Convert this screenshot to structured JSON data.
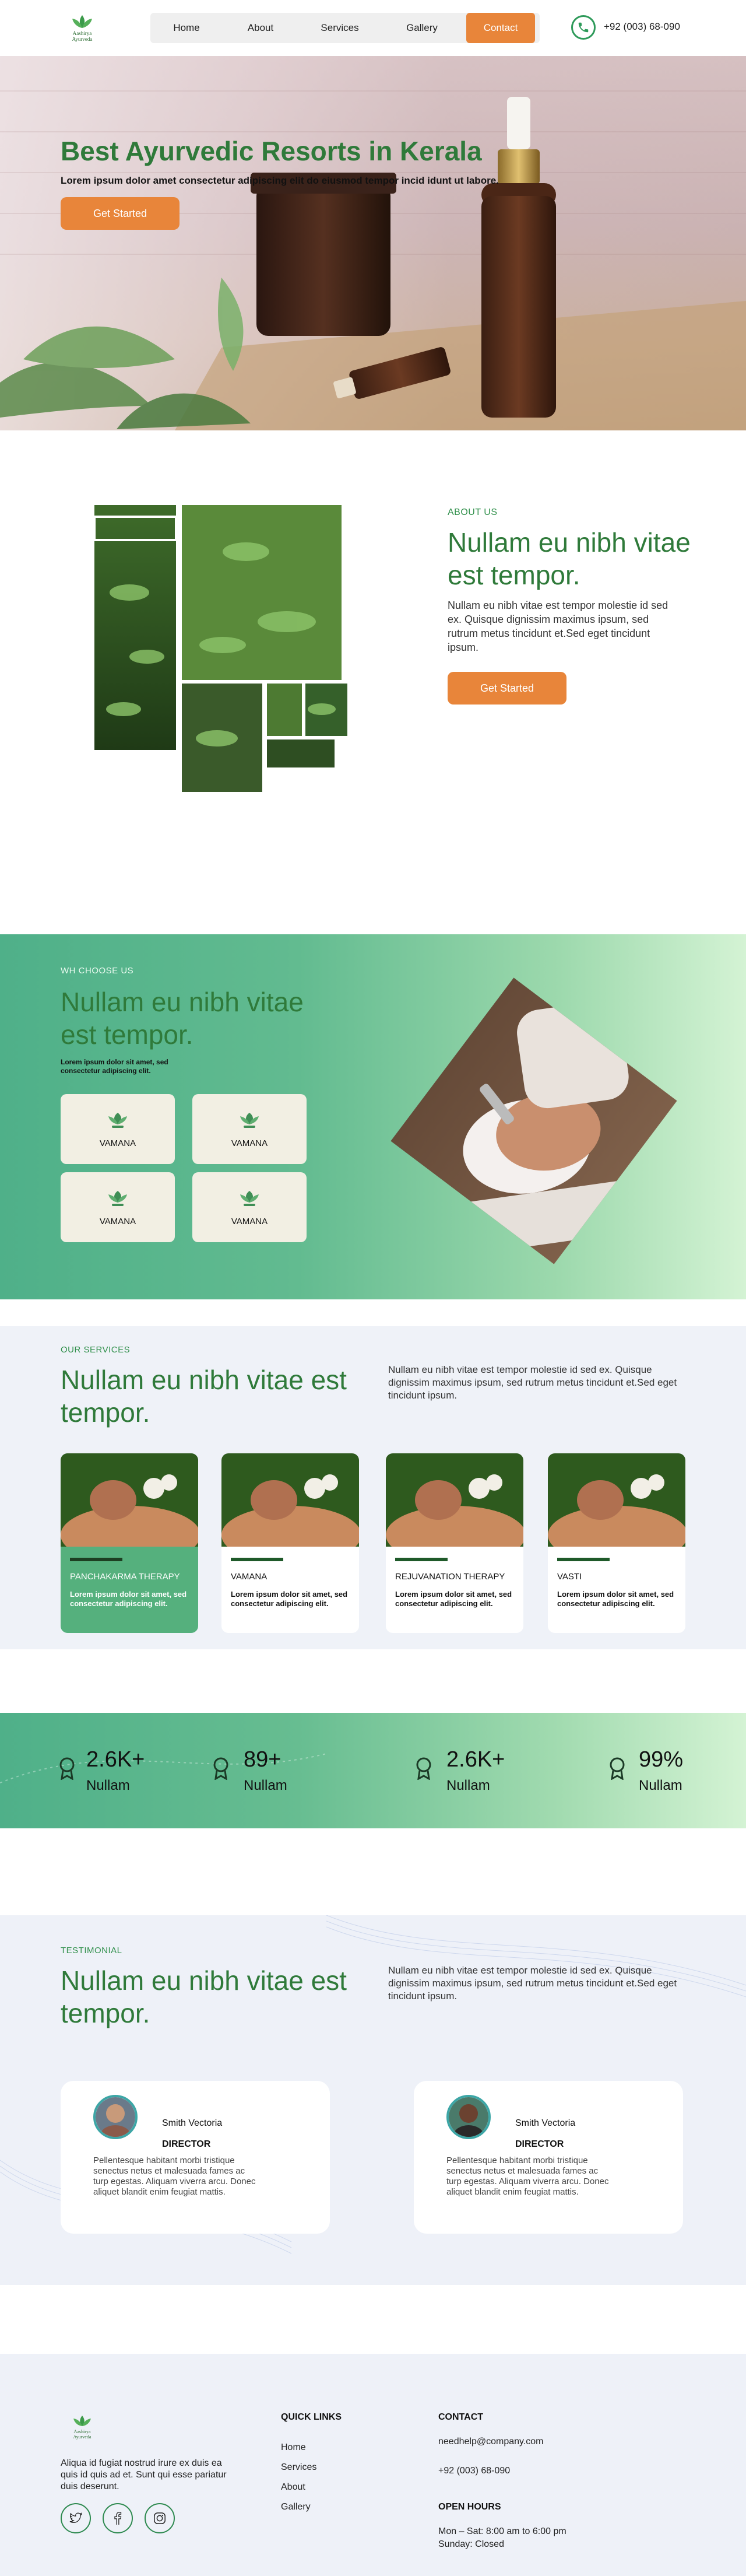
{
  "brand": {
    "logo_text_1": "Aashirya",
    "logo_text_2": "Ayurveda",
    "accent": "#e8853a",
    "green_primary": "#2f7a3a",
    "green_gradient_start": "#4fb089",
    "green_gradient_end": "#d4f3d4"
  },
  "nav": {
    "items": [
      "Home",
      "About",
      "Services",
      "Gallery",
      "Contact"
    ],
    "active": "Contact",
    "phone": "+92 (003) 68-090"
  },
  "hero": {
    "title": "Best Ayurvedic Resorts in Kerala",
    "subtitle": "Lorem ipsum dolor amet consectetur adipiscing elit do eiusmod tempor incid idunt ut labore.",
    "button": "Get Started"
  },
  "about": {
    "label": "ABOUT US",
    "title": "Nullam eu nibh vitae est tempor.",
    "text": "Nullam eu nibh vitae est tempor molestie id sed ex. Quisque dignissim maximus ipsum, sed rutrum metus tincidunt et.Sed eget tincidunt ipsum.",
    "button": "Get Started"
  },
  "why": {
    "label": "WH CHOOSE US",
    "title": "Nullam eu nibh vitae est tempor.",
    "text": "Lorem ipsum dolor sit amet, sed consectetur adipiscing elit.",
    "cards": [
      "VAMANA",
      "VAMANA",
      "VAMANA",
      "VAMANA"
    ]
  },
  "services": {
    "label": "OUR SERVICES",
    "title": "Nullam eu nibh vitae est tempor.",
    "text": "Nullam eu nibh vitae est tempor molestie id sed ex. Quisque dignissim maximus ipsum, sed rutrum metus tincidunt et.Sed eget tincidunt ipsum.",
    "cards": [
      {
        "name": "PANCHAKARMA THERAPY",
        "desc": "Lorem ipsum dolor sit amet, sed consectetur adipiscing elit."
      },
      {
        "name": "VAMANA",
        "desc": "Lorem ipsum dolor sit amet, sed consectetur adipiscing elit."
      },
      {
        "name": "REJUVANATION THERAPY",
        "desc": "Lorem ipsum dolor sit amet, sed consectetur adipiscing elit."
      },
      {
        "name": "VASTI",
        "desc": "Lorem ipsum dolor sit amet, sed consectetur adipiscing elit."
      }
    ]
  },
  "stats": [
    {
      "value": "2.6K+",
      "label": "Nullam"
    },
    {
      "value": "89+",
      "label": "Nullam"
    },
    {
      "value": "2.6K+",
      "label": "Nullam"
    },
    {
      "value": "99%",
      "label": "Nullam"
    }
  ],
  "testimonial": {
    "label": "TESTIMONIAL",
    "title": "Nullam eu nibh vitae est tempor.",
    "text": "Nullam eu nibh vitae est tempor molestie id sed ex. Quisque dignissim maximus ipsum, sed rutrum metus tincidunt et.Sed eget tincidunt ipsum.",
    "cards": [
      {
        "name": "Smith Vectoria",
        "role": "DIRECTOR",
        "quote": "Pellentesque habitant morbi tristique senectus netus et malesuada fames ac turp egestas. Aliquam viverra arcu. Donec aliquet blandit enim feugiat mattis."
      },
      {
        "name": "Smith Vectoria",
        "role": "DIRECTOR",
        "quote": "Pellentesque habitant morbi tristique senectus netus et malesuada fames ac turp egestas. Aliquam viverra arcu. Donec aliquet blandit enim feugiat mattis."
      }
    ]
  },
  "footer": {
    "about": "Aliqua id fugiat nostrud irure ex duis ea quis id quis ad et. Sunt qui esse pariatur duis deserunt.",
    "quick_links_title": "QUICK LINKS",
    "quick_links": [
      "Home",
      "Services",
      "About",
      "Gallery"
    ],
    "contact_title": "CONTACT",
    "email": "needhelp@company.com",
    "phone": "+92 (003) 68-090",
    "hours_title": "OPEN HOURS",
    "hours_1": "Mon – Sat: 8:00 am to 6:00 pm",
    "hours_2": "Sunday: Closed"
  }
}
